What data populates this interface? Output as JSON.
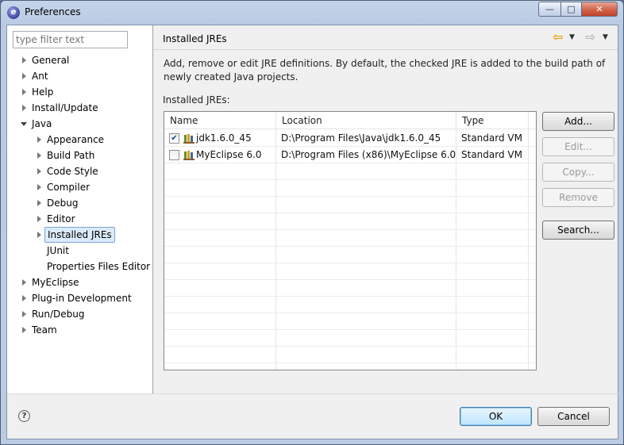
{
  "window": {
    "title": "Preferences",
    "min_glyph": "—",
    "max_glyph": "□",
    "close_glyph": "✕"
  },
  "filter": {
    "placeholder": "type filter text"
  },
  "tree": {
    "items": [
      {
        "label": "General",
        "expanded": false
      },
      {
        "label": "Ant",
        "expanded": false
      },
      {
        "label": "Help",
        "expanded": false
      },
      {
        "label": "Install/Update",
        "expanded": false
      },
      {
        "label": "Java",
        "expanded": true
      },
      {
        "label": "Appearance",
        "expanded": false
      },
      {
        "label": "Build Path",
        "expanded": false
      },
      {
        "label": "Code Style",
        "expanded": false
      },
      {
        "label": "Compiler",
        "expanded": false
      },
      {
        "label": "Debug",
        "expanded": false
      },
      {
        "label": "Editor",
        "expanded": false
      },
      {
        "label": "Installed JREs",
        "expanded": false,
        "selected": true
      },
      {
        "label": "JUnit"
      },
      {
        "label": "Properties Files Editor"
      },
      {
        "label": "MyEclipse",
        "expanded": false
      },
      {
        "label": "Plug-in Development",
        "expanded": false
      },
      {
        "label": "Run/Debug",
        "expanded": false
      },
      {
        "label": "Team",
        "expanded": false
      }
    ]
  },
  "page": {
    "title": "Installed JREs",
    "description_line1": "Add, remove or edit JRE definitions. By default, the checked JRE is added to the build path of",
    "description_line2": "newly created Java projects.",
    "table_caption": "Installed JREs:"
  },
  "table": {
    "columns": [
      "Name",
      "Location",
      "Type"
    ],
    "rows": [
      {
        "checked": true,
        "name": "jdk1.6.0_45",
        "location": "D:\\Program Files\\Java\\jdk1.6.0_45",
        "type": "Standard VM"
      },
      {
        "checked": false,
        "name": "MyEclipse 6.0",
        "location": "D:\\Program Files (x86)\\MyEclipse 6.0",
        "type": "Standard VM"
      }
    ]
  },
  "buttons": {
    "add": "Add...",
    "edit": "Edit...",
    "copy": "Copy...",
    "remove": "Remove",
    "search": "Search...",
    "ok": "OK",
    "cancel": "Cancel"
  },
  "nav": {
    "back_icon": "⇦",
    "forward_icon": "⇨",
    "dropdown_icon": "▼"
  },
  "help": {
    "icon": "?"
  },
  "colors": {
    "selection_bg": "#dcebfc",
    "selection_border": "#7da2ce",
    "back_arrow": "#e7a517"
  }
}
